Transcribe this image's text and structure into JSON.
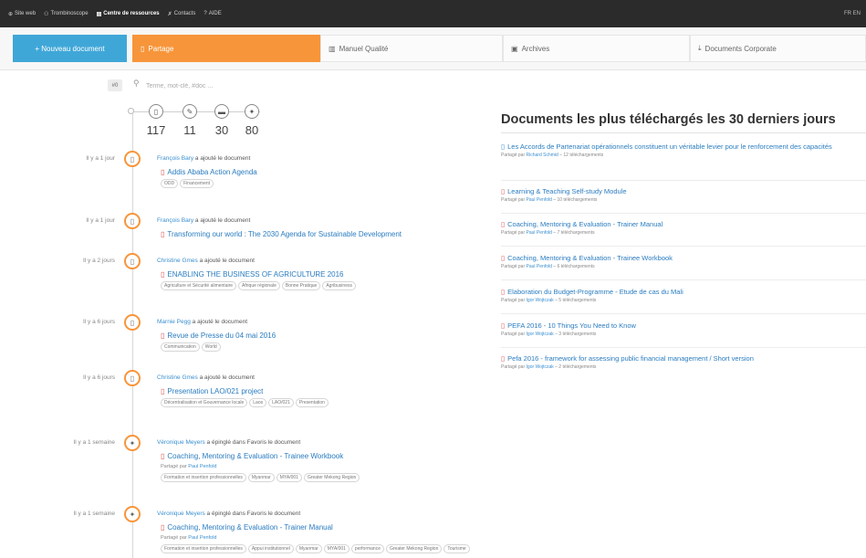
{
  "topnav": {
    "items": [
      {
        "label": "Site web",
        "icon": "globe-icon"
      },
      {
        "label": "Trombinoscope",
        "icon": "users-icon"
      },
      {
        "label": "Centre de ressources",
        "icon": "library-icon"
      },
      {
        "label": "Contacts",
        "icon": "pin-icon"
      },
      {
        "label": "AIDE",
        "icon": "question-icon"
      }
    ],
    "lang": "FR EN"
  },
  "new_document_label": "+ Nouveau document",
  "tabs": [
    {
      "label": "Partage",
      "icon": "document-icon"
    },
    {
      "label": "Manuel Qualité",
      "icon": "book-icon"
    },
    {
      "label": "Archives",
      "icon": "archive-icon"
    },
    {
      "label": "Documents Corporate",
      "icon": "download-icon"
    }
  ],
  "search": {
    "hash_label": "#0",
    "placeholder": "Terme, mot-clé, #doc ..."
  },
  "filter_counts": [
    {
      "icon": "document-icon",
      "count": "117"
    },
    {
      "icon": "pencil-icon",
      "count": "11"
    },
    {
      "icon": "comment-icon",
      "count": "30"
    },
    {
      "icon": "pin-icon",
      "count": "80"
    }
  ],
  "timeline": [
    {
      "time": "Il y a 1 jour",
      "kind": "document",
      "user": "François Bary",
      "action": " a ajouté le document",
      "doc": "Addis Ababa Action Agenda",
      "shared": "",
      "tags": [
        "ODD",
        "Financement"
      ]
    },
    {
      "time": "Il y a 1 jour",
      "kind": "document",
      "user": "François Bary",
      "action": " a ajouté le document",
      "doc": "Transforming our world : The 2030 Agenda for Sustainable Development",
      "shared": "",
      "tags": []
    },
    {
      "time": "Il y a 2 jours",
      "kind": "document",
      "user": "Christine Gmes",
      "action": " a ajouté le document",
      "doc": "ENABLING THE BUSINESS OF AGRICULTURE 2016",
      "shared": "",
      "tags": [
        "Agriculture et Sécurité alimentaire",
        "Afrique régionale",
        "Bonne Pratique",
        "Agribusiness"
      ]
    },
    {
      "time": "Il y a 6 jours",
      "kind": "document",
      "user": "Marnie Pegg",
      "action": " a ajouté le document",
      "doc": "Revue de Presse du 04 mai 2016",
      "shared": "",
      "tags": [
        "Communication",
        "World"
      ]
    },
    {
      "time": "Il y a 6 jours",
      "kind": "document",
      "user": "Christine Gmes",
      "action": " a ajouté le document",
      "doc": "Presentation LAO/021 project",
      "shared": "",
      "tags": [
        "Décentralisation et Gouvernance locale",
        "Laos",
        "LAO/021",
        "Presentation"
      ]
    },
    {
      "time": "Il y a 1 semaine",
      "kind": "pin",
      "user": "Véronique Meyers",
      "action": " a épinglé dans Favoris le document",
      "doc": "Coaching, Mentoring & Evaluation - Trainee Workbook",
      "shared_prefix": "Partagé par ",
      "shared": "Paul Penfold",
      "tags": [
        "Formation et insertion professionnelles",
        "Myanmar",
        "MYA/001",
        "Greater Mekong Region"
      ]
    },
    {
      "time": "Il y a 1 semaine",
      "kind": "pin",
      "user": "Véronique Meyers",
      "action": " a épinglé dans Favoris le document",
      "doc": "Coaching, Mentoring & Evaluation - Trainer Manual",
      "shared_prefix": "Partagé par ",
      "shared": "Paul Penfold",
      "tags": [
        "Formation et insertion professionnelles",
        "Appui institutionnel",
        "Myanmar",
        "MYA/001",
        "performance",
        "Greater Mekong Region",
        "Tourisme"
      ]
    }
  ],
  "top_docs": {
    "title": "Documents les plus téléchargés les 30 derniers jours",
    "items": [
      {
        "title": "Les Accords de Partenariat opérationnels constituent un véritable levier pour le renforcement des capacités",
        "by": "Richard Schmid",
        "downloads": "12 téléchargements",
        "icon": "document-blue"
      },
      {
        "title": "Learning & Teaching Self-study Module",
        "by": "Paul Penfold",
        "downloads": "10 téléchargements",
        "icon": "document-red"
      },
      {
        "title": "Coaching, Mentoring & Evaluation - Trainer Manual",
        "by": "Paul Penfold",
        "downloads": "7 téléchargements",
        "icon": "document-red"
      },
      {
        "title": "Coaching, Mentoring & Evaluation - Trainee Workbook",
        "by": "Paul Penfold",
        "downloads": "6 téléchargements",
        "icon": "document-red"
      },
      {
        "title": "Elaboration du Budget-Programme - Etude de cas du Mali",
        "by": "Igor Wojtczak",
        "downloads": "5 téléchargements",
        "icon": "document-red"
      },
      {
        "title": "PEFA 2016 - 10 Things You Need to Know",
        "by": "Igor Wojtczak",
        "downloads": "3 téléchargements",
        "icon": "document-red"
      },
      {
        "title": "Pefa 2016 - framework for assessing public financial management / Short version",
        "by": "Igor Wojtczak",
        "downloads": "2 téléchargements",
        "icon": "document-red"
      }
    ],
    "shared_prefix": "Partagé par "
  },
  "colors": {
    "accent": "#f7953a",
    "primary": "#3fa7d8",
    "link": "#2a7cc0",
    "doc_icon": "#d9534f"
  }
}
